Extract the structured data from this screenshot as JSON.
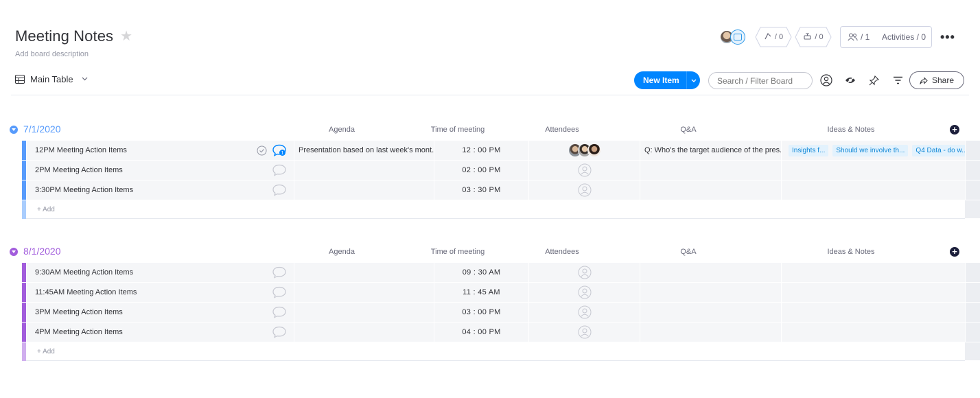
{
  "board": {
    "title": "Meeting Notes",
    "description": "Add board description"
  },
  "header": {
    "automations_count": "/ 0",
    "integrations_count": "/ 0",
    "members_count": "/ 1",
    "activities_label": "Activities / 0",
    "more_label": "•••"
  },
  "toolbar": {
    "view_label": "Main Table",
    "new_item_label": "New Item",
    "search_placeholder": "Search / Filter Board",
    "share_label": "Share"
  },
  "columns": {
    "agenda": "Agenda",
    "time": "Time of meeting",
    "attendees": "Attendees",
    "qa": "Q&A",
    "ideas": "Ideas & Notes"
  },
  "colors": {
    "group1": "#579bfc",
    "group1_light": "#a9cdfd",
    "group2": "#a25ddc",
    "group2_light": "#d0aeee",
    "accent": "#0085ff"
  },
  "groups": [
    {
      "title": "7/1/2020",
      "add_label": "+ Add",
      "rows": [
        {
          "name": "12PM Meeting Action Items",
          "agenda": "Presentation based on last week's mont...",
          "time": "12 : 00 PM",
          "qa": "Q: Who's the target audience of the pres...",
          "ideas": [
            "Insights f...",
            "Should we involve th...",
            "Q4 Data - do w..."
          ]
        },
        {
          "name": "2PM Meeting Action Items",
          "agenda": "",
          "time": "02 : 00 PM",
          "qa": "",
          "ideas": []
        },
        {
          "name": "3:30PM Meeting Action Items",
          "agenda": "",
          "time": "03 : 30 PM",
          "qa": "",
          "ideas": []
        }
      ]
    },
    {
      "title": "8/1/2020",
      "add_label": "+ Add",
      "rows": [
        {
          "name": "9:30AM Meeting Action Items",
          "time": "09 : 30 AM"
        },
        {
          "name": "11:45AM Meeting Action Items",
          "time": "11 : 45 AM"
        },
        {
          "name": "3PM Meeting Action Items",
          "time": "03 : 00 PM"
        },
        {
          "name": "4PM Meeting Action Items",
          "time": "04 : 00 PM"
        }
      ]
    }
  ]
}
